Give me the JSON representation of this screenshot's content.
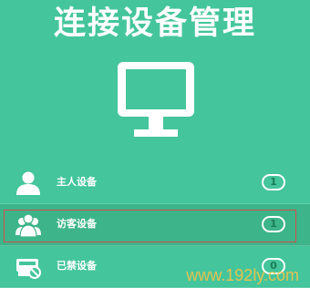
{
  "header": {
    "title": "连接设备管理"
  },
  "hero": {
    "icon": "monitor-icon"
  },
  "devices": [
    {
      "label": "主人设备",
      "count": "1",
      "icon": "user-icon",
      "selected": false
    },
    {
      "label": "访客设备",
      "count": "1",
      "icon": "group-users-icon",
      "selected": true
    },
    {
      "label": "已禁设备",
      "count": "0",
      "icon": "blocked-device-icon",
      "selected": false
    }
  ],
  "watermark": "www.192ly.com",
  "colors": {
    "background": "#44c59b",
    "selected_row": "#3db489",
    "highlight_border": "#d05050",
    "count_text": "#1b7c55"
  }
}
